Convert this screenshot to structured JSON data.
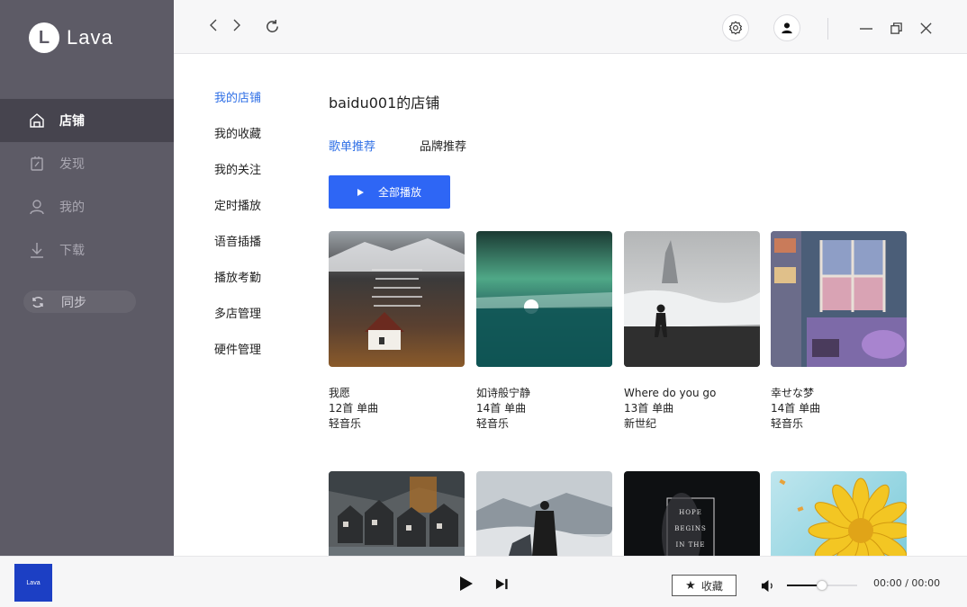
{
  "app": {
    "logo_letter": "L",
    "logo_text": "Lava"
  },
  "sidebar": {
    "items": [
      {
        "label": "店铺",
        "icon": "store-icon",
        "active": true
      },
      {
        "label": "发现",
        "icon": "discover-icon",
        "active": false
      },
      {
        "label": "我的",
        "icon": "user-icon",
        "active": false
      },
      {
        "label": "下载",
        "icon": "download-icon",
        "active": false
      }
    ],
    "sync_label": "同步"
  },
  "submenu": {
    "items": [
      {
        "label": "我的店铺",
        "active": true
      },
      {
        "label": "我的收藏",
        "active": false
      },
      {
        "label": "我的关注",
        "active": false
      },
      {
        "label": "定时播放",
        "active": false
      },
      {
        "label": "语音插播",
        "active": false
      },
      {
        "label": "播放考勤",
        "active": false
      },
      {
        "label": "多店管理",
        "active": false
      },
      {
        "label": "硬件管理",
        "active": false
      }
    ]
  },
  "main": {
    "title": "baidu001的店铺",
    "tabs": [
      {
        "label": "歌单推荐",
        "active": true
      },
      {
        "label": "品牌推荐",
        "active": false
      }
    ],
    "play_all_label": "全部播放",
    "playlists": [
      {
        "name": "我愿",
        "count": "12首 单曲",
        "genre": "轻音乐"
      },
      {
        "name": "如诗般宁静",
        "count": "14首 单曲",
        "genre": "轻音乐"
      },
      {
        "name": "Where do you go",
        "count": "13首 单曲",
        "genre": "新世纪"
      },
      {
        "name": "幸せな梦",
        "count": "14首 单曲",
        "genre": "轻音乐"
      }
    ],
    "hope_cover_text": [
      "HOPE",
      "BEGINS",
      "IN THE"
    ]
  },
  "player": {
    "thumb_text": "Lava",
    "favorite_label": "收藏",
    "time": "00:00 / 00:00",
    "volume_level": 0.5
  },
  "colors": {
    "accent": "#2e66f5",
    "link": "#2f6fe6",
    "sidebar_bg": "#5d5b66"
  }
}
